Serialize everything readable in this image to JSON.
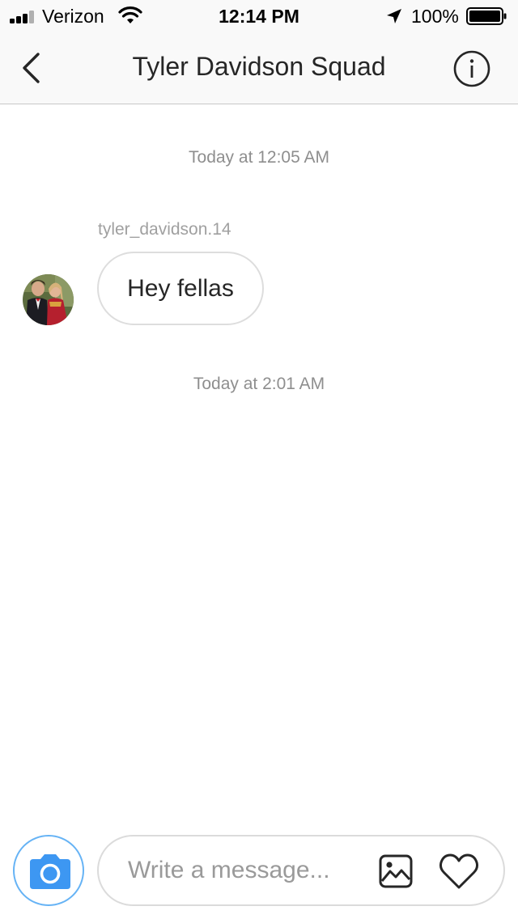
{
  "status_bar": {
    "carrier": "Verizon",
    "time": "12:14 PM",
    "battery_percent": "100%",
    "signal_icon": "signal-bars-icon",
    "wifi_icon": "wifi-icon",
    "location_icon": "location-arrow-icon",
    "battery_icon": "battery-icon"
  },
  "header": {
    "title": "Tyler Davidson Squad",
    "back_icon": "chevron-left-icon",
    "info_icon": "info-icon"
  },
  "conversation": {
    "timestamp_1": "Today at 12:05 AM",
    "message": {
      "sender": "tyler_davidson.14",
      "text": "Hey fellas"
    },
    "timestamp_2": "Today at 2:01 AM"
  },
  "composer": {
    "placeholder": "Write a message...",
    "camera_icon": "camera-icon",
    "gallery_icon": "image-gallery-icon",
    "heart_icon": "heart-icon"
  },
  "colors": {
    "accent_blue": "#3897f0",
    "text_primary": "#262626",
    "text_secondary": "#8e8e8e",
    "bar_background": "#f9f9f9"
  }
}
